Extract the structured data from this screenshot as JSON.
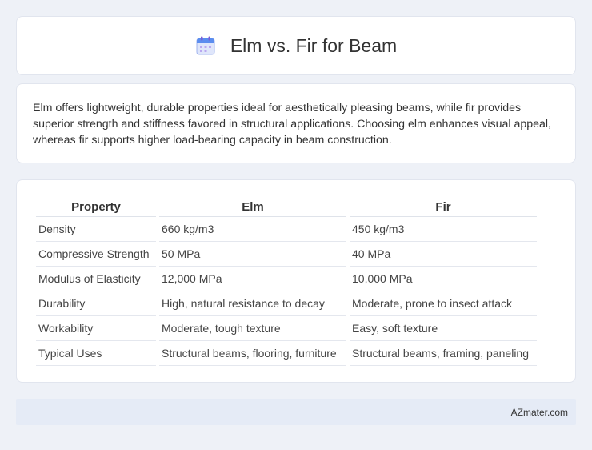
{
  "header": {
    "title": "Elm vs. Fir for Beam",
    "icon": "calendar-icon"
  },
  "description": "Elm offers lightweight, durable properties ideal for aesthetically pleasing beams, while fir provides superior strength and stiffness favored in structural applications. Choosing elm enhances visual appeal, whereas fir supports higher load-bearing capacity in beam construction.",
  "table": {
    "headers": [
      "Property",
      "Elm",
      "Fir"
    ],
    "rows": [
      [
        "Density",
        "660 kg/m3",
        "450 kg/m3"
      ],
      [
        "Compressive Strength",
        "50 MPa",
        "40 MPa"
      ],
      [
        "Modulus of Elasticity",
        "12,000 MPa",
        "10,000 MPa"
      ],
      [
        "Durability",
        "High, natural resistance to decay",
        "Moderate, prone to insect attack"
      ],
      [
        "Workability",
        "Moderate, tough texture",
        "Easy, soft texture"
      ],
      [
        "Typical Uses",
        "Structural beams, flooring, furniture",
        "Structural beams, framing, paneling"
      ]
    ]
  },
  "footer": {
    "brand": "AZmater.com"
  }
}
